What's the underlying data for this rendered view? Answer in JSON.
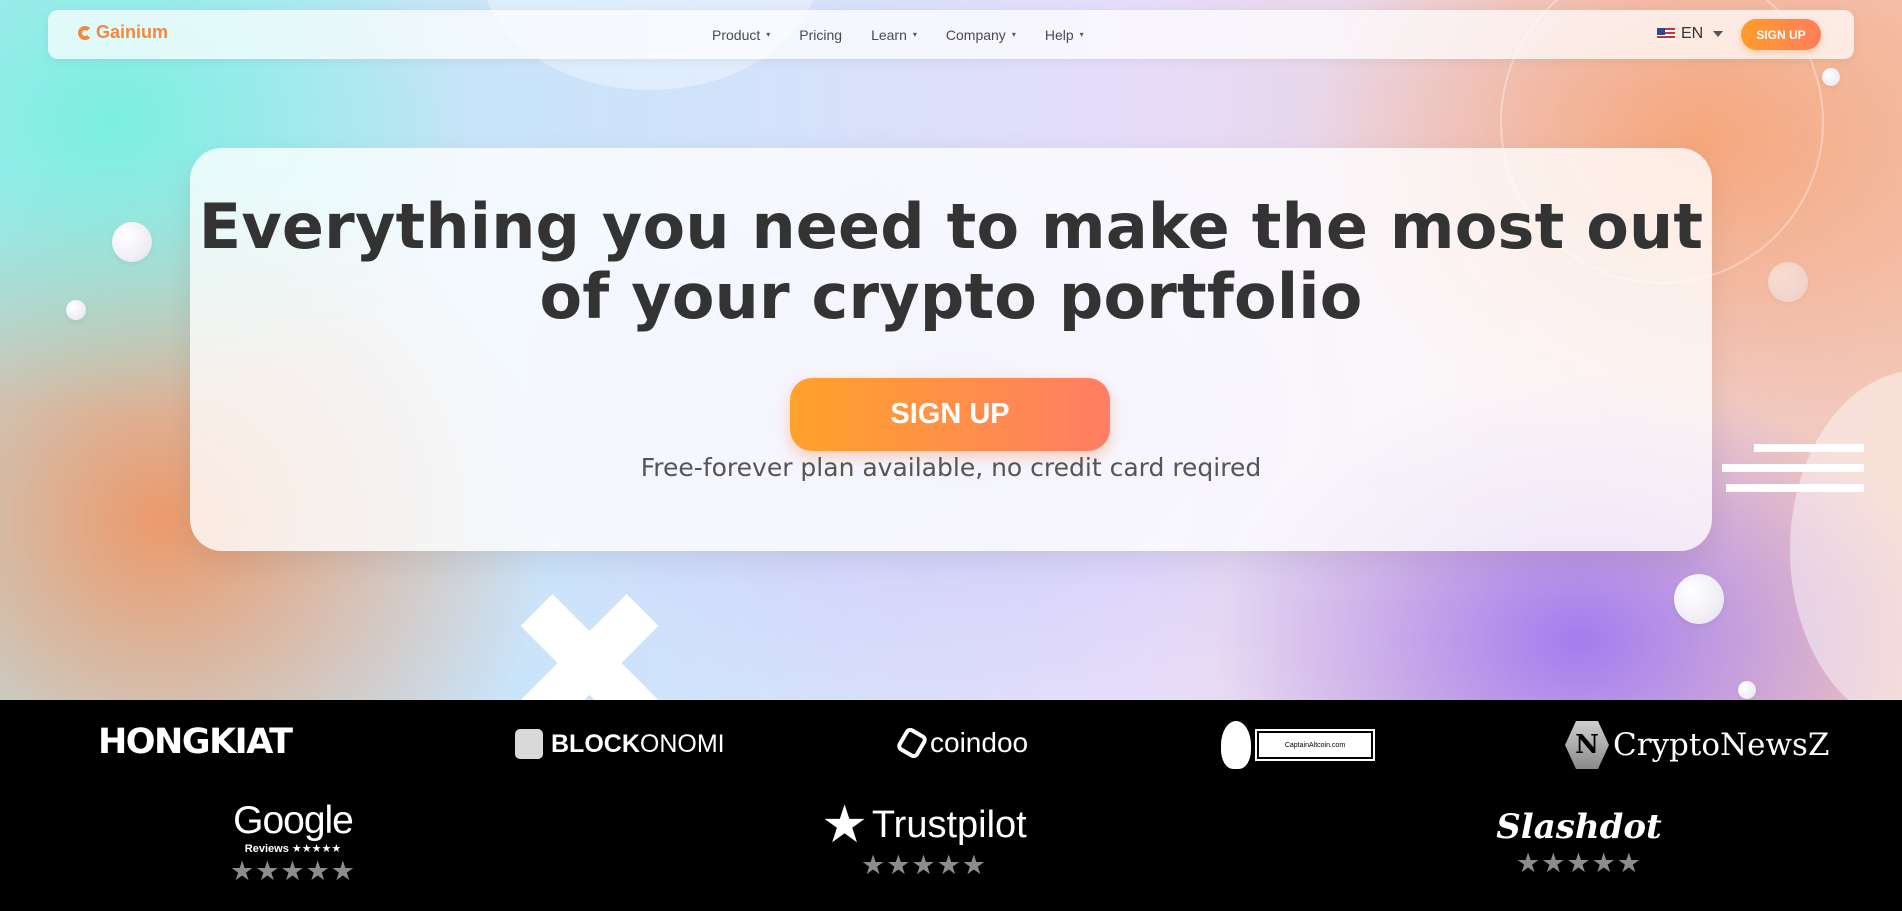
{
  "nav": {
    "logo_text": "Gainium",
    "menu": [
      {
        "label": "Product",
        "caret": "▾"
      },
      {
        "label": "Pricing",
        "caret": ""
      },
      {
        "label": "Learn",
        "caret": "▾"
      },
      {
        "label": "Company",
        "caret": "▾"
      },
      {
        "label": "Help",
        "caret": "▾"
      }
    ],
    "language": "EN",
    "signup_label": "SIGN UP"
  },
  "hero": {
    "headline_line1": "Everything you need to make the most out",
    "headline_line2": "of your crypto portfolio",
    "cta_label": "SIGN UP",
    "subtext": "Free-forever plan available, no credit card reqired"
  },
  "press": {
    "hongkiat": "HONGKIAT",
    "blockonomi_bold": "BLOCK",
    "blockonomi_rest": "ONOMI",
    "coindoo": "coindoo",
    "captainaltcoin": "CaptainAltcoin.com",
    "cryptonewsz": "CryptoNewsZ",
    "cryptonewsz_mark": "N"
  },
  "reviews": {
    "google": {
      "name": "Google",
      "sub": "Reviews ★★★★★",
      "stars": "★★★★★"
    },
    "trustpilot": {
      "name": "Trustpilot",
      "star": "★",
      "stars": "★★★★★"
    },
    "slashdot": {
      "name": "Slashdot",
      "stars": "★★★★★"
    }
  },
  "colors": {
    "brand_orange": "#f5873f",
    "cta_gradient_start": "#ffa22b",
    "cta_gradient_end": "#ff7e64",
    "headline_text": "#333333",
    "strip_background": "#000000"
  }
}
